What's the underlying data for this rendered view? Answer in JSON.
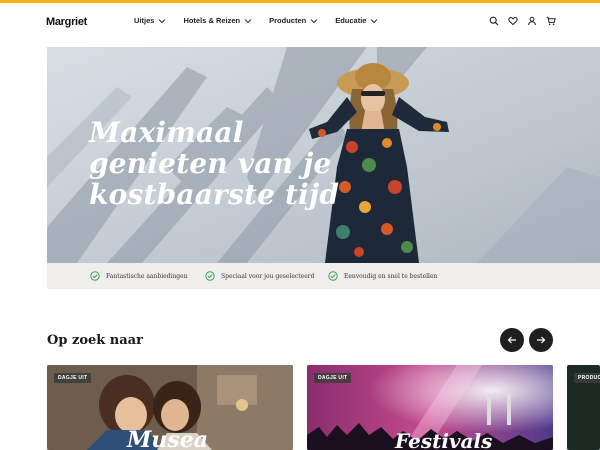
{
  "brand": {
    "logo": "Margriet",
    "accent": "#f6b31b"
  },
  "nav": {
    "items": [
      {
        "label": "Uitjes"
      },
      {
        "label": "Hotels & Reizen"
      },
      {
        "label": "Producten"
      },
      {
        "label": "Educatie"
      }
    ],
    "icons": [
      "search-icon",
      "heart-icon",
      "user-icon",
      "cart-icon"
    ]
  },
  "hero": {
    "title_line1": "Maximaal",
    "title_line2": "genieten van je",
    "title_line3": "kostbaarste tijd"
  },
  "usps": [
    {
      "text": "Fantastische aanbiedingen"
    },
    {
      "text": "Speciaal voor jou geselecteerd"
    },
    {
      "text": "Eenvoudig en snel te bestellen"
    }
  ],
  "section": {
    "title": "Op zoek naar",
    "prev_icon": "arrow-left-icon",
    "next_icon": "arrow-right-icon"
  },
  "cards": [
    {
      "tag": "DAGJE UIT",
      "title": "Musea"
    },
    {
      "tag": "DAGJE UIT",
      "title": "Festivals"
    },
    {
      "tag": "PRODUCT"
    }
  ]
}
